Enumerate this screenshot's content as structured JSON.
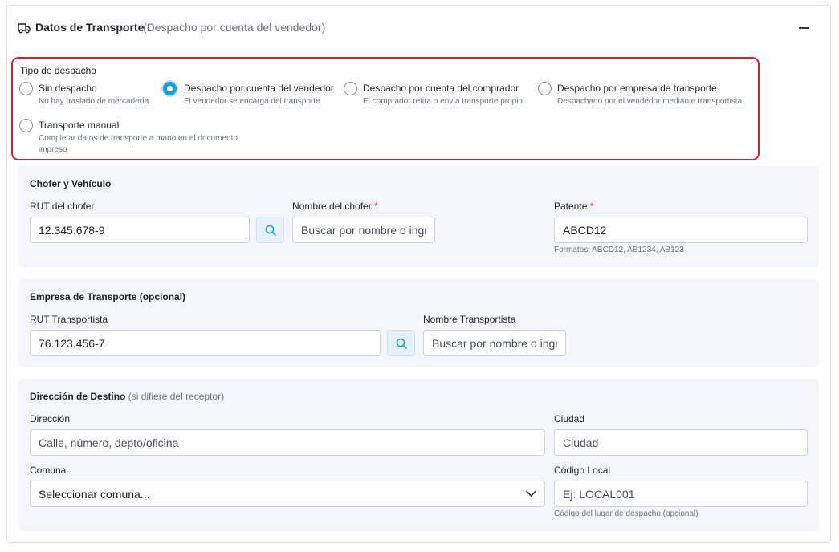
{
  "header": {
    "title": "Datos de Transporte",
    "subtitle": "(Despacho por cuenta del vendedor)",
    "icon": "truck-icon",
    "collapse_icon": "minus-icon"
  },
  "dispatch": {
    "label": "Tipo de despacho",
    "options": [
      {
        "title": "Sin despacho",
        "desc": "No hay traslado de mercadería",
        "checked": false
      },
      {
        "title": "Despacho por cuenta del vendedor",
        "desc": "El vendedor se encarga del transporte",
        "checked": true
      },
      {
        "title": "Despacho por cuenta del comprador",
        "desc": "El comprador retira o envía transporte propio",
        "checked": false
      },
      {
        "title": "Despacho por empresa de transporte",
        "desc": "Despachado por el vendedor mediante transportista",
        "checked": false
      },
      {
        "title": "Transporte manual",
        "desc": "Completar datos de transporte a mano en el documento impreso",
        "checked": false
      }
    ]
  },
  "driver": {
    "title": "Chofer y Vehículo",
    "rut_label": "RUT del chofer",
    "rut_value": "12.345.678-9",
    "name_label": "Nombre del chofer",
    "name_placeholder": "Buscar por nombre o ingrese manualmente",
    "plate_label": "Patente",
    "plate_value": "ABCD12",
    "plate_help": "Formatos: ABCD12, AB1234, AB123",
    "required_mark": "*"
  },
  "company": {
    "title": "Empresa de Transporte (opcional)",
    "rut_label": "RUT Transportista",
    "rut_value": "76.123.456-7",
    "name_label": "Nombre Transportista",
    "name_placeholder": "Buscar por nombre o ingrese manualmente"
  },
  "destination": {
    "title": "Dirección de Destino",
    "title_note": "(si difiere del receptor)",
    "address_label": "Dirección",
    "address_placeholder": "Calle, número, depto/oficina",
    "city_label": "Ciudad",
    "city_placeholder": "Ciudad",
    "comuna_label": "Comuna",
    "comuna_value": "Seleccionar comuna...",
    "local_label": "Código Local",
    "local_placeholder": "Ej: LOCAL001",
    "local_help": "Código del lugar de despacho (opcional)"
  },
  "colors": {
    "accent": "#1a9fd9",
    "highlight_border": "#dc1c2e",
    "section_bg": "#f4f6fb",
    "required": "#dc3545"
  }
}
